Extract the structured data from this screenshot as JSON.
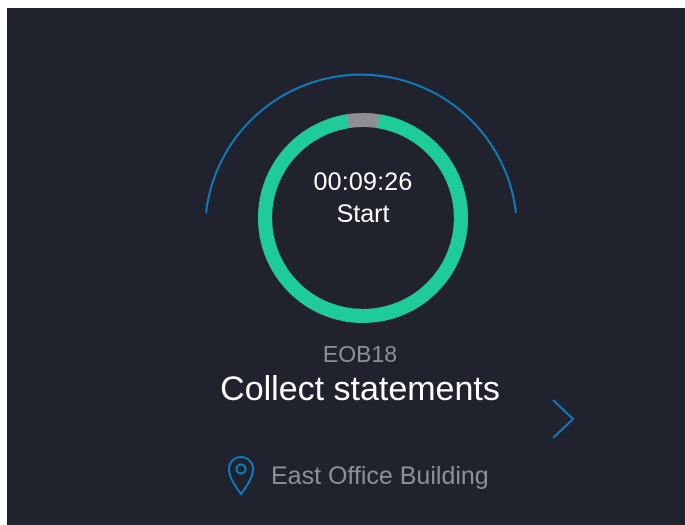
{
  "timer": {
    "elapsed": "00:09:26",
    "action_label": "Start",
    "progress_fraction": 0.95
  },
  "task": {
    "code": "EOB18",
    "title": "Collect statements"
  },
  "location": {
    "name": "East Office Building",
    "icon": "location-pin-icon"
  },
  "colors": {
    "background": "#20232e",
    "progress_ring": "#1ecc9a",
    "progress_remaining": "#8f8f93",
    "outer_arc": "#0e7dc1",
    "muted_text": "#8d9098",
    "text": "#ffffff"
  }
}
